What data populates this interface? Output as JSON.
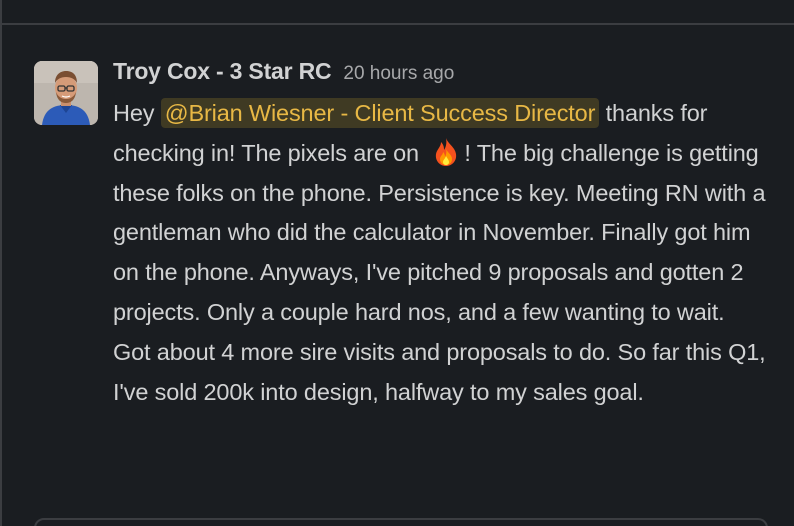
{
  "message": {
    "sender": "Troy Cox - 3 Star RC",
    "timestamp": "20 hours ago",
    "mention": "@Brian Wiesner - Client Success Director",
    "text_before_mention": "Hey ",
    "text_after_mention": " thanks for checking in! The pixels are on ",
    "emoji": "fire-emoji",
    "text_after_emoji": "! The big challenge is getting these folks on the phone. Persistence is key. Meeting RN with a gentleman who did the calculator in November. Finally got him on the phone. Anyways, I've pitched 9 proposals and gotten 2 projects. Only a couple hard nos, and a few wanting to wait. Got about 4 more sire visits and proposals to do. So far this Q1, I've sold 200k into design, halfway to my sales goal."
  },
  "colors": {
    "background": "#1a1d21",
    "text": "#d1d2d3",
    "mention_bg": "#3f3a23",
    "mention_text": "#e8b845",
    "timestamp": "#a7a8aa"
  }
}
